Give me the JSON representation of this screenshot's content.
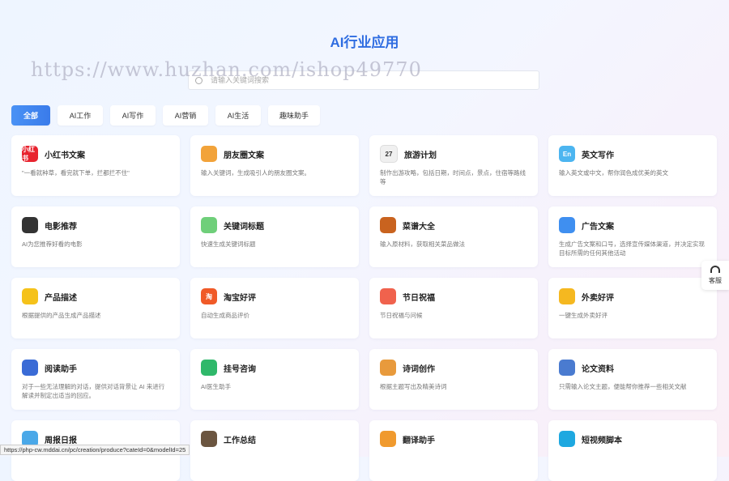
{
  "header": {
    "title": "AI行业应用"
  },
  "watermark": "https://www.huzhan.com/ishop49770",
  "search": {
    "placeholder": "请输入关键词搜索",
    "value": ""
  },
  "tabs": [
    {
      "label": "全部",
      "active": true
    },
    {
      "label": "AI工作"
    },
    {
      "label": "AI写作"
    },
    {
      "label": "AI营销"
    },
    {
      "label": "AI生活"
    },
    {
      "label": "趣味助手"
    }
  ],
  "cards": [
    {
      "title": "小红书文案",
      "desc": "\"一看就种草，看完就下单，拦都拦不住\"",
      "icon": "xiaohongshu-icon",
      "icon_text": "小红书",
      "color": "#e8242f"
    },
    {
      "title": "朋友圈文案",
      "desc": "输入关键词，生成吸引人的朋友圈文案。",
      "icon": "color-wheel-icon",
      "color": "#f2a33a"
    },
    {
      "title": "旅游计划",
      "desc": "制作出游攻略，包括日期，时间点，景点，住宿等路线等",
      "icon": "calendar-icon",
      "icon_text": "27",
      "color": "#f0f0f0"
    },
    {
      "title": "英文写作",
      "desc": "输入英文或中文，帮你润色成优美的英文",
      "icon": "en-icon",
      "icon_text": "En",
      "color": "#4cb5f0"
    },
    {
      "title": "电影推荐",
      "desc": "AI为您推荐好看的电影",
      "icon": "clapperboard-icon",
      "color": "#333333"
    },
    {
      "title": "关键词标题",
      "desc": "快速生成关键词标题",
      "icon": "keyword-search-icon",
      "color": "#6fcf7a"
    },
    {
      "title": "菜谱大全",
      "desc": "输入原材料，获取相关菜品做法",
      "icon": "dish-icon",
      "color": "#c9631f"
    },
    {
      "title": "广告文案",
      "desc": "生成广告文案和口号，选择宣传媒体渠道，并决定实现目标所需的任何其他活动",
      "icon": "gear-icon",
      "color": "#3f8ff0"
    },
    {
      "title": "产品描述",
      "desc": "根据提供的产品生成产品描述",
      "icon": "shopping-bag-icon",
      "color": "#f5c21a"
    },
    {
      "title": "淘宝好评",
      "desc": "自动生成商品评价",
      "icon": "taobao-icon",
      "icon_text": "淘",
      "color": "#f05a28"
    },
    {
      "title": "节日祝福",
      "desc": "节日祝福与问候",
      "icon": "festival-icon",
      "color": "#f0624d"
    },
    {
      "title": "外卖好评",
      "desc": "一键生成外卖好评",
      "icon": "takeout-icon",
      "color": "#f5b820"
    },
    {
      "title": "阅读助手",
      "desc": "对于一些无法理解的对话，提供对话背景让 AI 来进行解读并制定出适当的回应。",
      "icon": "books-icon",
      "color": "#3a6bd6"
    },
    {
      "title": "挂号咨询",
      "desc": "AI医生助手",
      "icon": "hospital-icon",
      "color": "#2fb86a"
    },
    {
      "title": "诗词创作",
      "desc": "根据主题写出及精美诗词",
      "icon": "open-book-icon",
      "color": "#e89a3c"
    },
    {
      "title": "论文资料",
      "desc": "只需输入论文主题，便能帮你推荐一些相关文献",
      "icon": "binders-icon",
      "color": "#4a7bd0"
    },
    {
      "title": "周报日报",
      "desc": "",
      "icon": "report-icon",
      "color": "#4aa8e8"
    },
    {
      "title": "工作总结",
      "desc": "",
      "icon": "briefcase-icon",
      "color": "#6b5540"
    },
    {
      "title": "翻译助手",
      "desc": "",
      "icon": "translate-icon",
      "color": "#f09a2e"
    },
    {
      "title": "短视频脚本",
      "desc": "",
      "icon": "video-clapper-icon",
      "color": "#1ea8e0"
    }
  ],
  "side_help": {
    "label": "客服"
  },
  "status_url": "https://php-cw.mddai.cn/pc/creation/produce?cateId=0&modelId=25"
}
